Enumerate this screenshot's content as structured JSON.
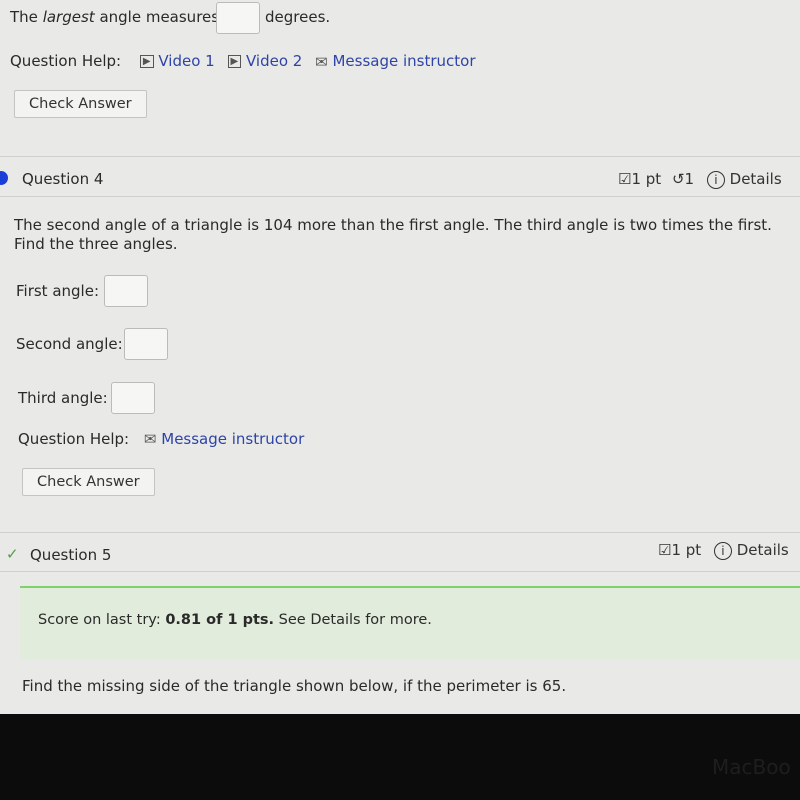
{
  "q3": {
    "prefix": "The",
    "emph": "largest",
    "mid": "angle measures",
    "suffix": "degrees.",
    "help_label": "Question Help:",
    "video1": "Video 1",
    "video2": "Video 2",
    "message": "Message instructor",
    "check": "Check Answer"
  },
  "q4": {
    "title": "Question 4",
    "points": "1 pt",
    "retries": "1",
    "details": "Details",
    "text": "The second angle of a triangle is 104 more than the first angle. The third angle is two times the first. Find the three angles.",
    "first_label": "First angle:",
    "second_label": "Second angle:",
    "third_label": "Third angle:",
    "help_label": "Question Help:",
    "message": "Message instructor",
    "check": "Check Answer"
  },
  "q5": {
    "title": "Question 5",
    "points": "1 pt",
    "details": "Details",
    "score_prefix": "Score on last try:",
    "score_value": "0.81 of 1 pts.",
    "score_suffix": "See Details for more.",
    "text": "Find the missing side of the triangle shown below, if the perimeter is 65."
  },
  "bezel_logo": "MacBook",
  "colors": {
    "accent": "#2e44a8",
    "success": "#7cd36b",
    "current_dot": "#1a3fd8"
  }
}
